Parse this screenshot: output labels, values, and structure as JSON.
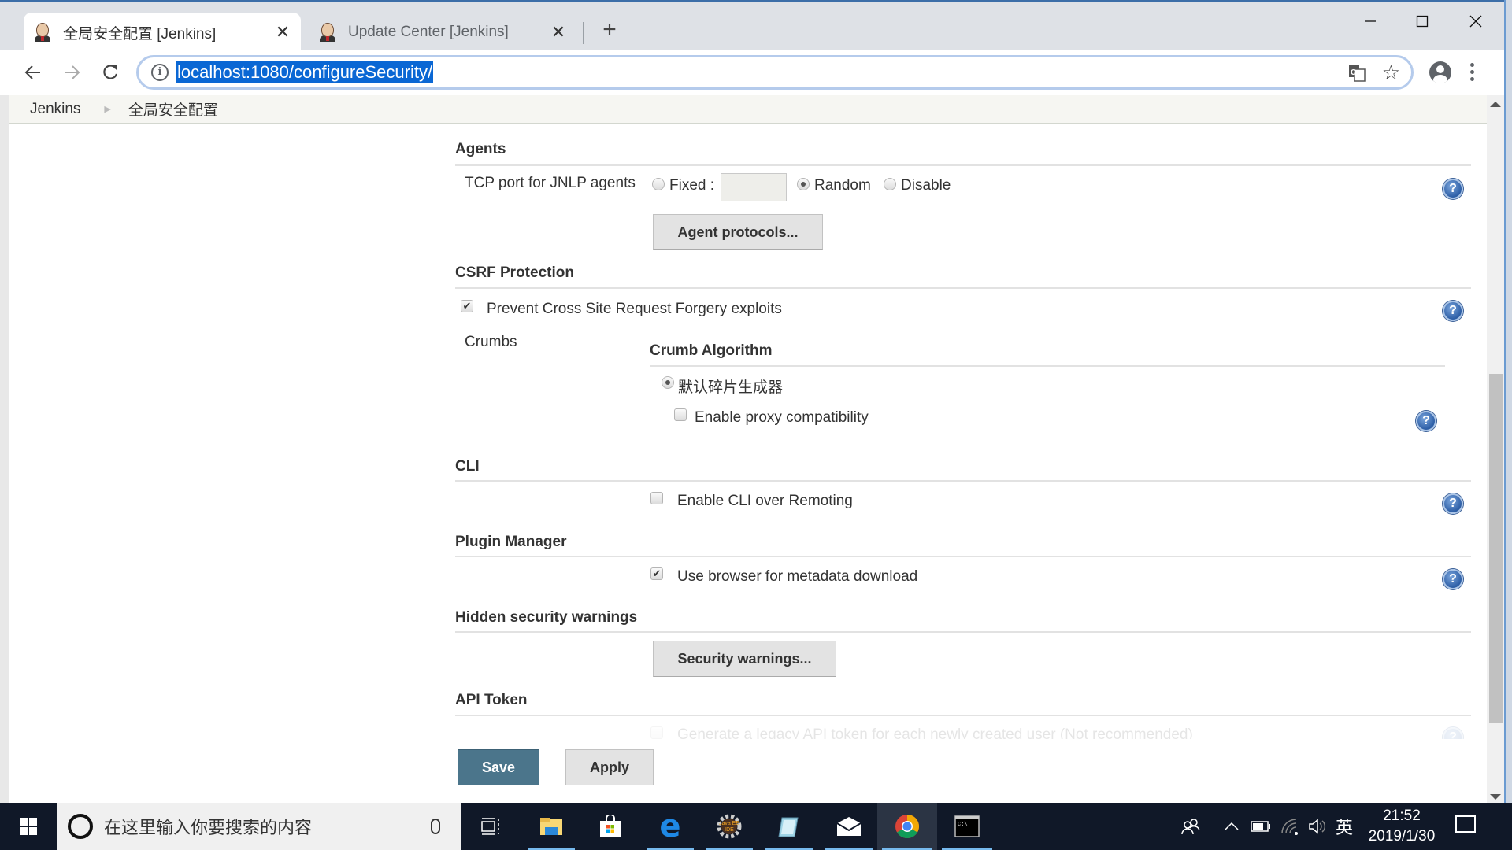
{
  "browser": {
    "tabs": [
      {
        "title": "全局安全配置 [Jenkins]",
        "active": true,
        "icon": "jenkins-favicon"
      },
      {
        "title": "Update Center [Jenkins]",
        "active": false,
        "icon": "jenkins-favicon"
      }
    ],
    "close_glyph": "✕",
    "new_tab_glyph": "+",
    "url": "localhost:1080/configureSecurity/",
    "window_controls": {
      "minimize": "minimize-icon",
      "maximize": "maximize-icon",
      "close": "close-icon"
    }
  },
  "breadcrumb": {
    "items": [
      "Jenkins",
      "全局安全配置"
    ],
    "separator": "▶"
  },
  "form": {
    "agents": {
      "title": "Agents",
      "tcp_label": "TCP port for JNLP agents",
      "options": [
        {
          "label": "Fixed :",
          "selected": false
        },
        {
          "label": "Random",
          "selected": true
        },
        {
          "label": "Disable",
          "selected": false
        }
      ],
      "fixed_port_value": "",
      "protocols_button": "Agent protocols..."
    },
    "csrf": {
      "title": "CSRF Protection",
      "prevent_label": "Prevent Cross Site Request Forgery exploits",
      "prevent_checked": true,
      "crumbs_label": "Crumbs",
      "crumb_algorithm_title": "Crumb Algorithm",
      "default_issuer_label": "默认碎片生成器",
      "default_issuer_selected": true,
      "proxy_label": "Enable proxy compatibility",
      "proxy_checked": false
    },
    "cli": {
      "title": "CLI",
      "remoting_label": "Enable CLI over Remoting",
      "remoting_checked": false
    },
    "plugin_manager": {
      "title": "Plugin Manager",
      "browser_download_label": "Use browser for metadata download",
      "browser_download_checked": true
    },
    "hidden_warnings": {
      "title": "Hidden security warnings",
      "button": "Security warnings..."
    },
    "api_token": {
      "title": "API Token",
      "faded_option_label": "Generate a legacy API token for each newly created user (Not recommended)"
    },
    "help_glyph": "?",
    "save_button": "Save",
    "apply_button": "Apply"
  },
  "taskbar": {
    "search_placeholder": "在这里输入你要搜索的内容",
    "apps": [
      "task-view",
      "file-explorer",
      "microsoft-store",
      "edge",
      "java-ee-ide",
      "notepad",
      "mail",
      "chrome",
      "command-prompt"
    ],
    "ime": "英",
    "time": "21:52",
    "date": "2019/1/30"
  }
}
